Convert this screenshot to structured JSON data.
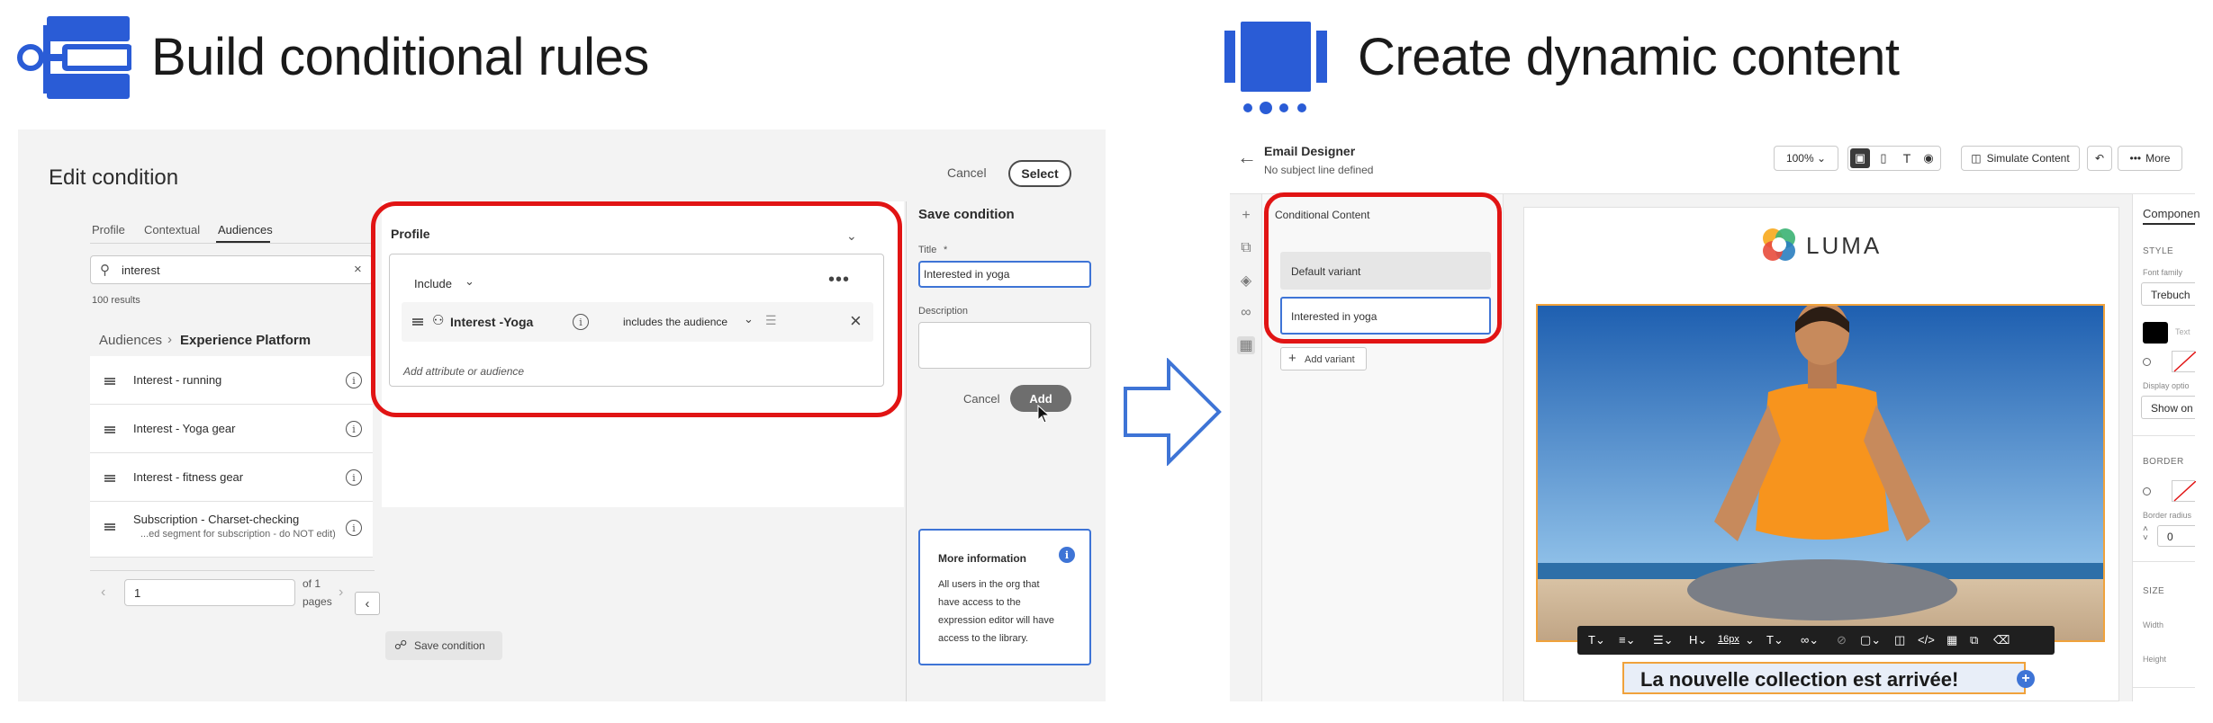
{
  "left_header": {
    "title": "Build conditional rules",
    "icon": "rule-builder-icon"
  },
  "right_header": {
    "title": "Create dynamic content",
    "icon": "dynamic-content-icon"
  },
  "edit_condition": {
    "title": "Edit condition",
    "cancel": "Cancel",
    "select": "Select",
    "tabs": [
      "Profile",
      "Contextual",
      "Audiences"
    ],
    "search_value": "interest",
    "results": "100 results",
    "breadcrumb_root": "Audiences",
    "breadcrumb_current": "Experience Platform",
    "list": [
      {
        "label": "Interest - running",
        "sub": ""
      },
      {
        "label": "Interest - Yoga gear",
        "sub": ""
      },
      {
        "label": "Interest - fitness gear",
        "sub": ""
      },
      {
        "label": "Subscription - Charset-checking",
        "sub": "...ed segment for subscription - do NOT edit)"
      }
    ],
    "page_value": "1",
    "of_label": "of 1",
    "pages_label": "pages",
    "profile_header": "Profile",
    "include_label": "Include",
    "rule_label": "Interest -Yoga",
    "operator": "includes the audience",
    "add_placeholder": "Add attribute or audience",
    "save_condition_btn": "Save condition",
    "save_panel": {
      "title": "Save condition",
      "title_label": "Title",
      "title_required": "*",
      "title_value": "Interested in yoga",
      "description_label": "Description",
      "cancel": "Cancel",
      "add": "Add"
    },
    "more_info": {
      "title": "More information",
      "body": [
        "All users in the org that",
        "have access to the",
        "expression editor will have",
        "access to the library."
      ]
    }
  },
  "email_designer": {
    "title": "Email Designer",
    "subtitle": "No subject line defined",
    "zoom": "100%",
    "simulate": "Simulate Content",
    "more": "More",
    "conditional_header": "Conditional Content",
    "variants": [
      "Default variant",
      "Interested in yoga"
    ],
    "add_variant": "Add variant",
    "logo_text": "LUMA",
    "headline": "La nouvelle collection est arrivée!",
    "font_size": "16px",
    "props": {
      "tab": "Componen",
      "style": "STYLE",
      "font_family_label": "Font family",
      "font_family_value": "Trebuch",
      "text_label": "Text",
      "display_label": "Display optio",
      "display_value": "Show on",
      "border": "BORDER",
      "border_radius": "Border radius",
      "radius_value": "0",
      "size": "SIZE",
      "width": "Width",
      "height": "Height"
    }
  },
  "colors": {
    "accent": "#2a5cd6",
    "red_highlight": "#e11414",
    "panel_bg": "#f3f3f3"
  }
}
